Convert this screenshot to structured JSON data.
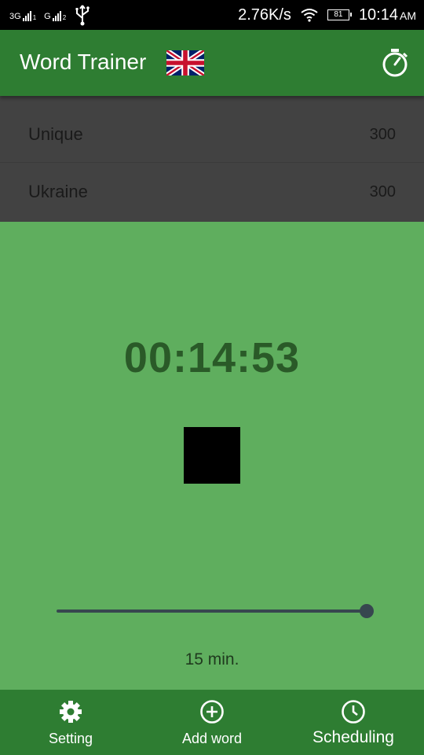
{
  "status_bar": {
    "sim1_label": "3G",
    "sim1_sub": "1",
    "sim2_label": "G",
    "sim2_sub": "2",
    "net_speed": "2.76K/s",
    "battery": "81",
    "time": "10:14",
    "ampm": "AM",
    "icons": [
      "signal-icon",
      "usb-icon",
      "wifi-icon",
      "battery-icon"
    ]
  },
  "app_bar": {
    "title": "Word Trainer",
    "flag_icon": "uk-flag-icon",
    "action_icon": "stopwatch-icon"
  },
  "word_list": [
    {
      "word": "Unique",
      "count": "300"
    },
    {
      "word": "Ukraine",
      "count": "300"
    }
  ],
  "trainer": {
    "timer": "00:14:53",
    "stop_icon": "stop-icon",
    "slider_value_fraction": 1.0,
    "slider_label": "15 min."
  },
  "bottom_nav": [
    {
      "label": "Setting",
      "icon": "gear-icon"
    },
    {
      "label": "Add word",
      "icon": "add-circle-icon"
    },
    {
      "label": "Scheduling",
      "icon": "clock-icon"
    }
  ],
  "colors": {
    "primary": "#2e7d32",
    "background": "#5fae5e",
    "list_background": "#424242",
    "timer_text": "#2a5a28"
  }
}
